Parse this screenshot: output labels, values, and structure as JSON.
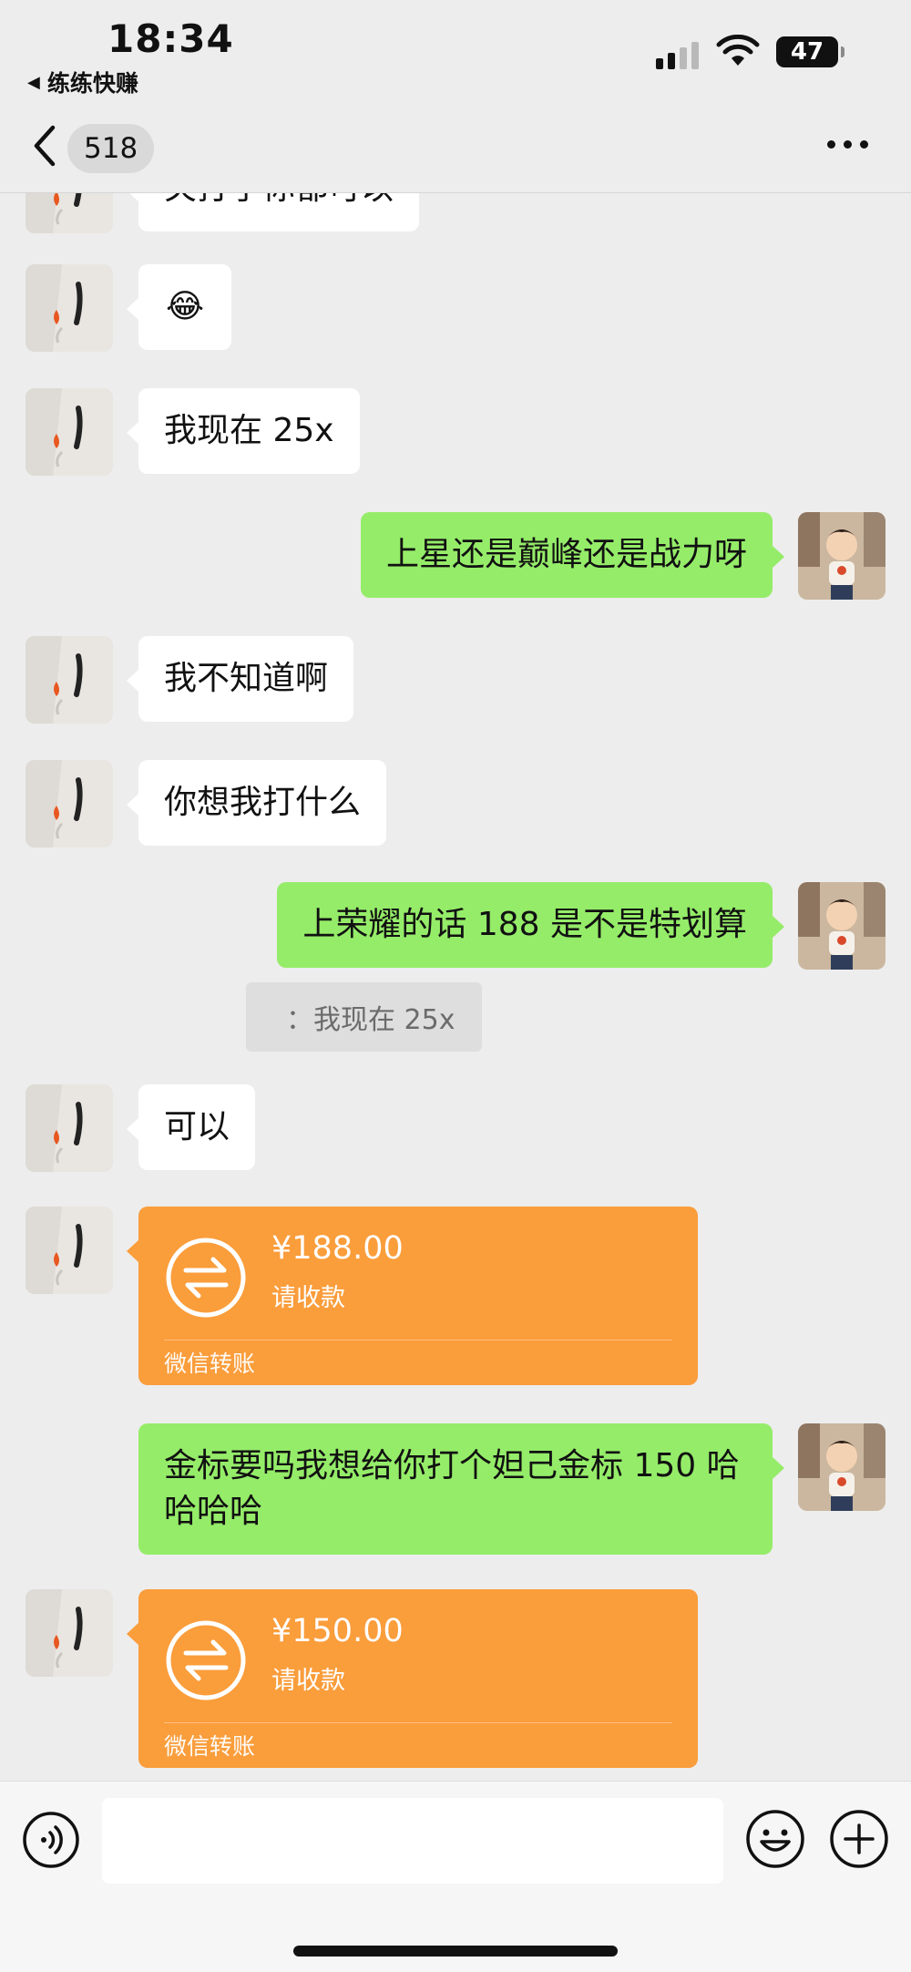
{
  "status_bar": {
    "time": "18:34",
    "back_app": "练练快赚",
    "battery": "47"
  },
  "nav": {
    "unread_count": "518"
  },
  "messages": [
    {
      "side": "left",
      "text": "关打了你都可以"
    },
    {
      "side": "left",
      "text": "😂"
    },
    {
      "side": "left",
      "text": "我现在 25x"
    },
    {
      "side": "right",
      "text": "上星还是巅峰还是战力呀"
    },
    {
      "side": "left",
      "text": "我不知道啊"
    },
    {
      "side": "left",
      "text": "你想我打什么"
    },
    {
      "side": "right",
      "text": "上荣耀的话 188 是不是特划算",
      "quote": "：我现在 25x"
    },
    {
      "side": "left",
      "text": "可以"
    },
    {
      "side": "left",
      "type": "transfer",
      "amount": "¥188.00",
      "status": "请收款",
      "footer": "微信转账"
    },
    {
      "side": "right",
      "text": "金标要吗我想给你打个妲己金标 150 哈哈哈哈"
    },
    {
      "side": "left",
      "type": "transfer",
      "amount": "¥150.00",
      "status": "请收款",
      "footer": "微信转账"
    }
  ],
  "colors": {
    "background": "#ededed",
    "bubble_self": "#95ec69",
    "bubble_other": "#ffffff",
    "transfer": "#fa9d3b"
  }
}
